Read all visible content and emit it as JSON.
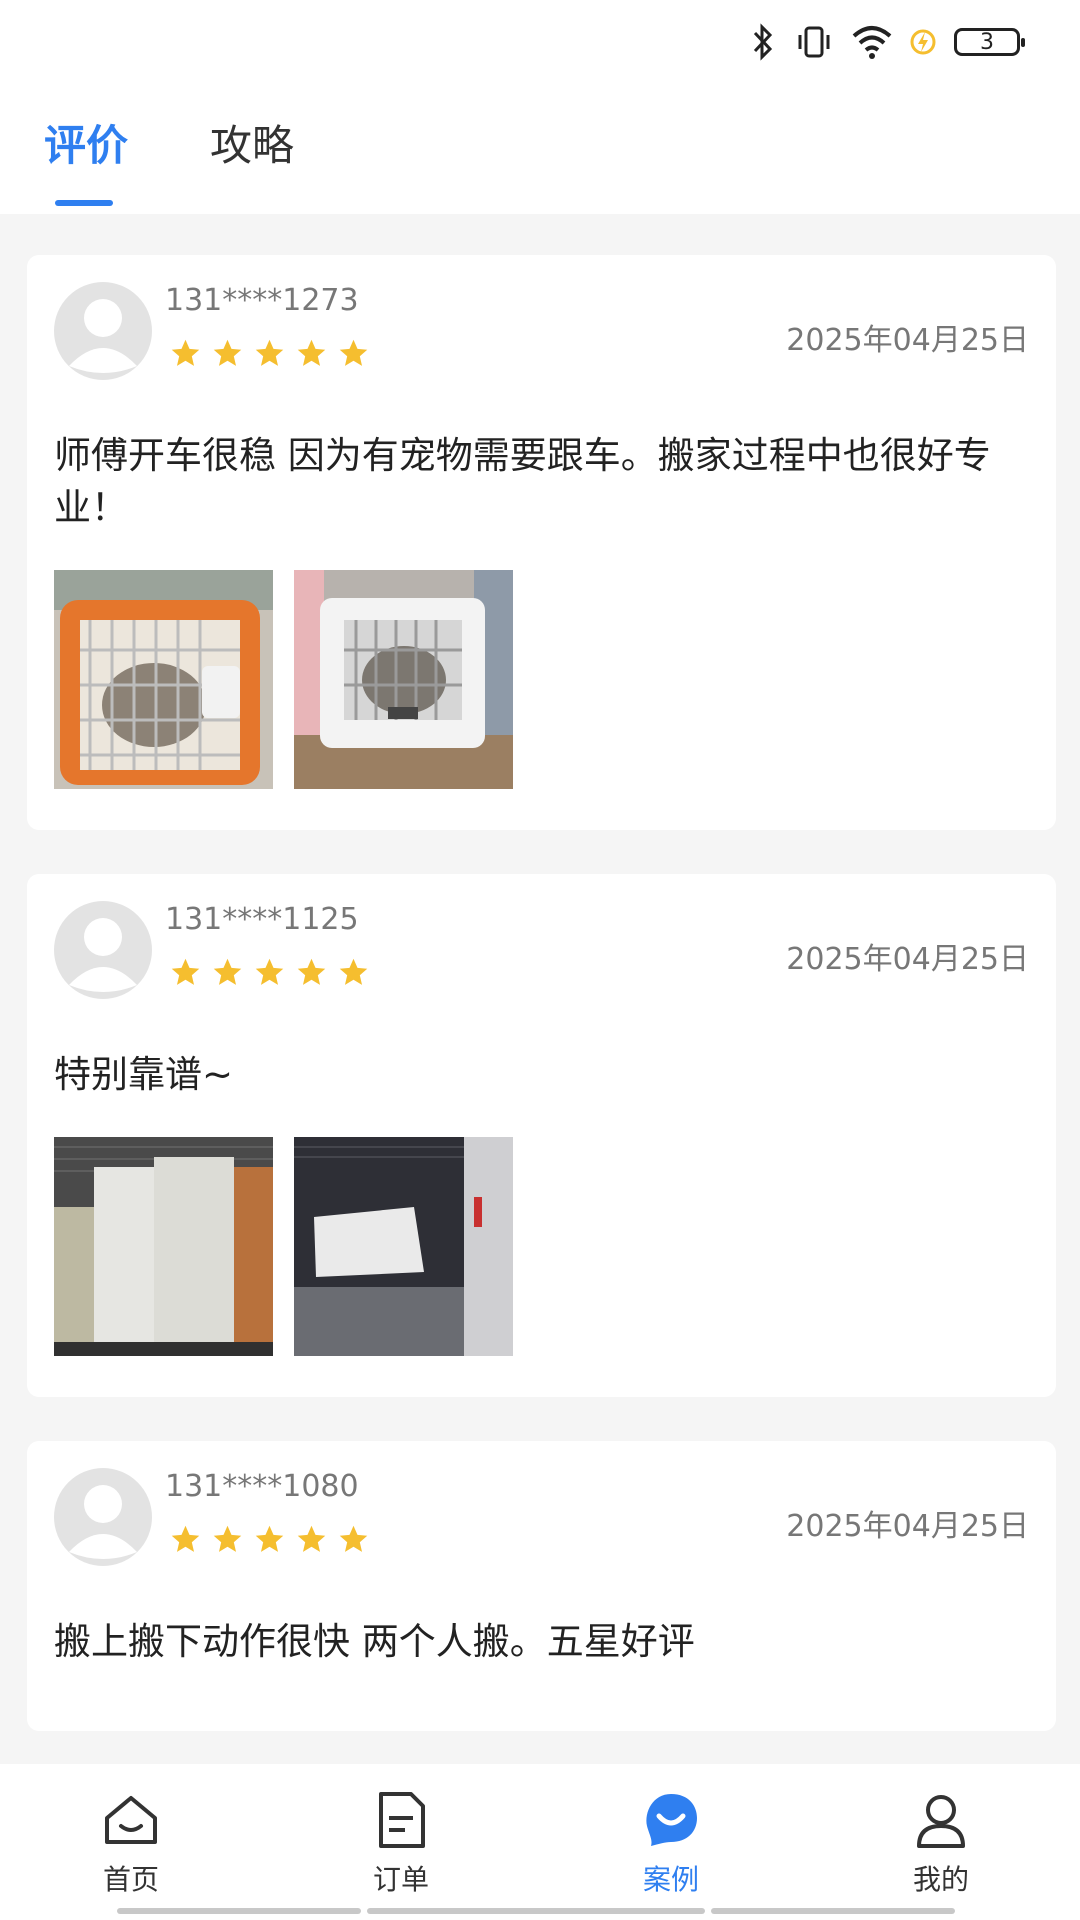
{
  "status": {
    "battery": "3"
  },
  "tabs": [
    {
      "label": "评价",
      "active": true
    },
    {
      "label": "攻略",
      "active": false
    }
  ],
  "reviews": [
    {
      "user": "131****1273",
      "stars": 5,
      "date": "2025年04月25日",
      "text": "师傅开车很稳 因为有宠物需要跟车。搬家过程中也很好专业！",
      "photos": [
        "orange-pet-carrier-photo",
        "white-pet-carrier-photo"
      ]
    },
    {
      "user": "131****1125",
      "stars": 5,
      "date": "2025年04月25日",
      "text": "特别靠谱~",
      "photos": [
        "wrapped-furniture-photo",
        "truck-cargo-photo"
      ]
    },
    {
      "user": "131****1080",
      "stars": 5,
      "date": "2025年04月25日",
      "text": "搬上搬下动作很快 两个人搬。五星好评",
      "photos": []
    }
  ],
  "nav": [
    {
      "label": "首页",
      "icon": "home-icon"
    },
    {
      "label": "订单",
      "icon": "order-icon"
    },
    {
      "label": "案例",
      "icon": "case-chat-icon",
      "active": true
    },
    {
      "label": "我的",
      "icon": "profile-icon"
    }
  ],
  "colors": {
    "accent": "#2f7ff0",
    "star": "#f5be2f"
  }
}
